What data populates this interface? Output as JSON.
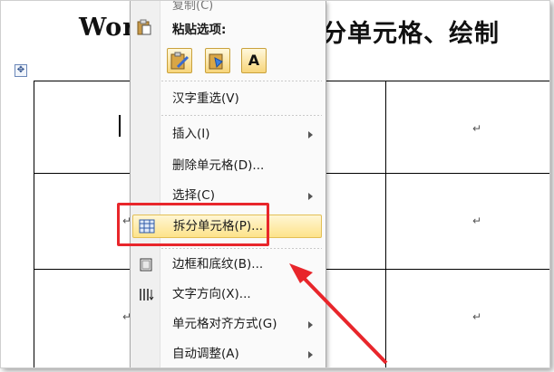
{
  "document": {
    "title_left": "Wor",
    "title_right": "分单元格、绘制",
    "cell_mark": "↵",
    "table_move_icon": "move-cross-icon"
  },
  "menu": {
    "top_item_partial": "复制(C)",
    "paste_options_label": "粘贴选项:",
    "paste_buttons": [
      {
        "name": "keep-source-format-icon"
      },
      {
        "name": "merge-format-icon"
      },
      {
        "name": "keep-text-only-icon",
        "glyph": "A"
      }
    ],
    "items": [
      {
        "label": "汉字重选(V)",
        "submenu": false
      },
      {
        "label": "插入(I)",
        "submenu": true
      },
      {
        "label": "删除单元格(D)...",
        "submenu": false
      },
      {
        "label": "选择(C)",
        "submenu": true
      },
      {
        "label": "拆分单元格(P)...",
        "submenu": false,
        "highlighted": true,
        "icon": "split-cells-icon"
      },
      {
        "label": "边框和底纹(B)...",
        "submenu": false,
        "icon": "borders-shading-icon"
      },
      {
        "label": "文字方向(X)...",
        "submenu": false,
        "icon": "text-direction-icon"
      },
      {
        "label": "单元格对齐方式(G)",
        "submenu": true
      },
      {
        "label": "自动调整(A)",
        "submenu": true
      }
    ]
  },
  "annotation": {
    "highlight_color": "#e8262b"
  }
}
